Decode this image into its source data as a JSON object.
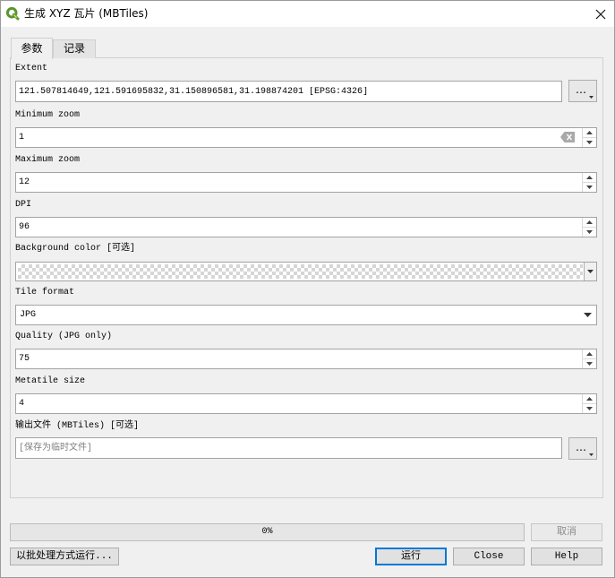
{
  "window": {
    "title": "生成 XYZ 瓦片 (MBTiles)",
    "icon": "qgis-logo-icon",
    "close_icon": "close-icon"
  },
  "tabs": [
    {
      "label": "参数",
      "active": true
    },
    {
      "label": "记录",
      "active": false
    }
  ],
  "params": {
    "extent": {
      "label": "Extent",
      "value": "121.507814649,121.591695832,31.150896581,31.198874201 [EPSG:4326]",
      "button_label": "…"
    },
    "min_zoom": {
      "label": "Minimum zoom",
      "value": "1"
    },
    "max_zoom": {
      "label": "Maximum zoom",
      "value": "12"
    },
    "dpi": {
      "label": "DPI",
      "value": "96"
    },
    "background_color": {
      "label": "Background color [可选]"
    },
    "tile_format": {
      "label": "Tile format",
      "value": "JPG"
    },
    "quality": {
      "label": "Quality (JPG only)",
      "value": "75"
    },
    "metatile_size": {
      "label": "Metatile size",
      "value": "4"
    },
    "output_file": {
      "label": "输出文件 (MBTiles) [可选]",
      "placeholder": "[保存为临时文件]",
      "button_label": "…"
    }
  },
  "progress": {
    "text": "0%",
    "fraction": 0
  },
  "buttons": {
    "cancel": {
      "label": "取消",
      "enabled": false
    },
    "batch": {
      "label": "以批处理方式运行..."
    },
    "run": {
      "label": "运行",
      "focused": true
    },
    "close": {
      "label": "Close"
    },
    "help": {
      "label": "Help"
    }
  },
  "colors": {
    "accent": "#0078d7",
    "brand": "#589632",
    "progress": "#06b025"
  }
}
